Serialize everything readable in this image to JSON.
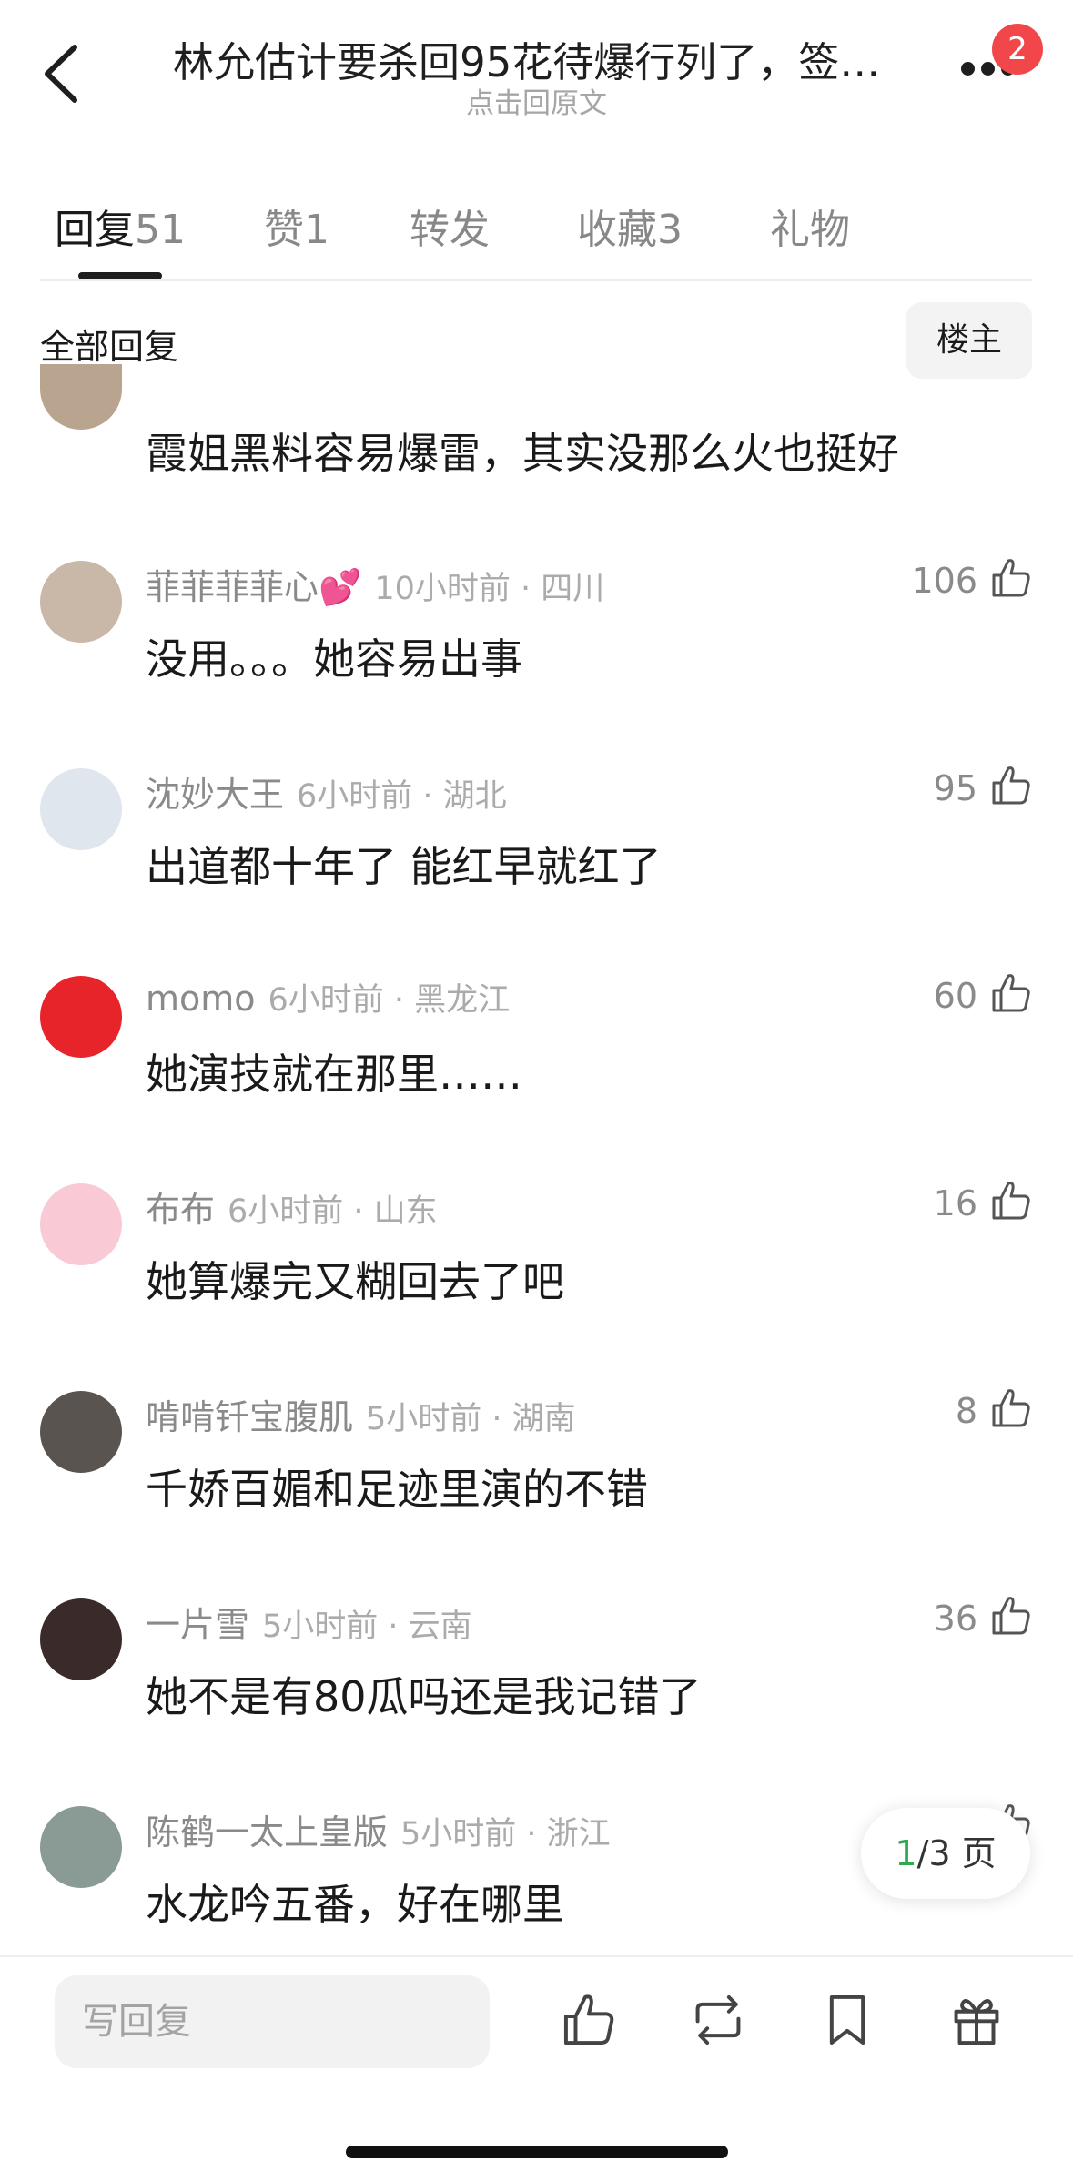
{
  "header": {
    "title": "林允估计要杀回95花待爆行列了，签…",
    "subtitle": "点击回原文",
    "notification_count": "2"
  },
  "tabs": [
    {
      "label": "回复",
      "count": "51"
    },
    {
      "label": "赞",
      "count": "1"
    },
    {
      "label": "转发",
      "count": ""
    },
    {
      "label": "收藏",
      "count": "3"
    },
    {
      "label": "礼物",
      "count": ""
    }
  ],
  "section": {
    "title": "全部回复",
    "owner_button": "楼主"
  },
  "partial_comment": {
    "text": "霞姐黑料容易爆雷，其实没那么火也挺好"
  },
  "comments": [
    {
      "user": "菲菲菲菲心💕",
      "meta": "10小时前 · 四川",
      "text": "没用。。。她容易出事",
      "likes": "106",
      "avatar_color": "#c9b7a8"
    },
    {
      "user": "沈妙大王",
      "meta": "6小时前 · 湖北",
      "text": "出道都十年了 能红早就红了",
      "likes": "95",
      "avatar_color": "#dfe6ee"
    },
    {
      "user": "momo",
      "meta": "6小时前 · 黑龙江",
      "text": "她演技就在那里……",
      "likes": "60",
      "avatar_color": "#e8242b"
    },
    {
      "user": "布布",
      "meta": "6小时前 · 山东",
      "text": "她算爆完又糊回去了吧",
      "likes": "16",
      "avatar_color": "#f9c9d6"
    },
    {
      "user": "啃啃钎宝腹肌",
      "meta": "5小时前 · 湖南",
      "text": "千娇百媚和足迹里演的不错",
      "likes": "8",
      "avatar_color": "#5a5450"
    },
    {
      "user": "一片雪",
      "meta": "5小时前 · 云南",
      "text": "她不是有80瓜吗还是我记错了",
      "likes": "36",
      "avatar_color": "#3a2a2a"
    },
    {
      "user": "陈鹤一太上皇版",
      "meta": "5小时前 · 浙江",
      "text": "水龙吟五番，好在哪里",
      "likes": "",
      "avatar_color": "#8a9a94"
    }
  ],
  "pager": {
    "current": "1",
    "rest": "/3 页"
  },
  "bottom_bar": {
    "reply_placeholder": "写回复"
  }
}
